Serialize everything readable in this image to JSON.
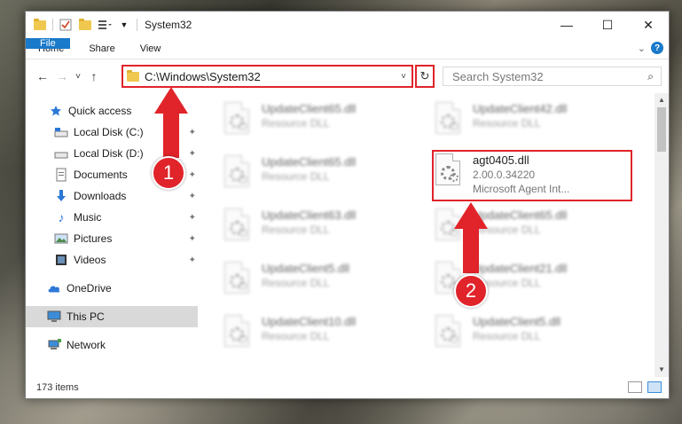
{
  "window": {
    "title": "System32",
    "controls": {
      "minimize": "—",
      "maximize": "☐",
      "close": "✕"
    }
  },
  "ribbon": {
    "tabs": [
      "File",
      "Home",
      "Share",
      "View"
    ],
    "expand_icon": "chevron-down",
    "help_label": "?"
  },
  "address": {
    "back": "←",
    "forward": "→",
    "recent": "˅",
    "up": "↑",
    "path": "C:\\Windows\\System32",
    "dropdown": "˅",
    "refresh": "↻"
  },
  "search": {
    "placeholder": "Search System32",
    "icon": "⌕"
  },
  "nav": {
    "items": [
      {
        "label": "Quick access",
        "icon": "star-icon",
        "pinned": false
      },
      {
        "label": "Local Disk (C:)",
        "icon": "drive-icon",
        "pinned": true
      },
      {
        "label": "Local Disk (D:)",
        "icon": "drive-icon",
        "pinned": true
      },
      {
        "label": "Documents",
        "icon": "documents-icon",
        "pinned": true
      },
      {
        "label": "Downloads",
        "icon": "downloads-icon",
        "pinned": true
      },
      {
        "label": "Music",
        "icon": "music-icon",
        "pinned": true
      },
      {
        "label": "Pictures",
        "icon": "pictures-icon",
        "pinned": true
      },
      {
        "label": "Videos",
        "icon": "videos-icon",
        "pinned": true
      },
      {
        "label": "OneDrive",
        "icon": "onedrive-icon",
        "pinned": false
      },
      {
        "label": "This PC",
        "icon": "pc-icon",
        "pinned": false,
        "selected": true
      },
      {
        "label": "Network",
        "icon": "network-icon",
        "pinned": false
      }
    ],
    "pin_glyph": "📌"
  },
  "files": {
    "left": [
      {
        "name": "UpdateClient65.dll",
        "type": "Resource DLL"
      },
      {
        "name": "UpdateClient65.dll",
        "type": "Resource DLL"
      },
      {
        "name": "UpdateClient63.dll",
        "type": "Resource DLL"
      },
      {
        "name": "UpdateClient5.dll",
        "type": "Resource DLL"
      },
      {
        "name": "UpdateClient10.dll",
        "type": "Resource DLL"
      }
    ],
    "right": [
      {
        "name": "UpdateClient42.dll",
        "type": "Resource DLL"
      },
      {
        "name": "UpdateClient65.dll",
        "type": "Resource DLL"
      },
      {
        "name": "UpdateClient21.dll",
        "type": "Resource DLL"
      },
      {
        "name": "UpdateClient5.dll",
        "type": "Resource DLL"
      }
    ],
    "highlighted": {
      "name": "agt0405.dll",
      "version": "2.00.0.34220",
      "description": "Microsoft Agent Int..."
    }
  },
  "status": {
    "count": "173 items"
  },
  "annotations": {
    "badge1": "1",
    "badge2": "2",
    "color": "#e0242a"
  }
}
